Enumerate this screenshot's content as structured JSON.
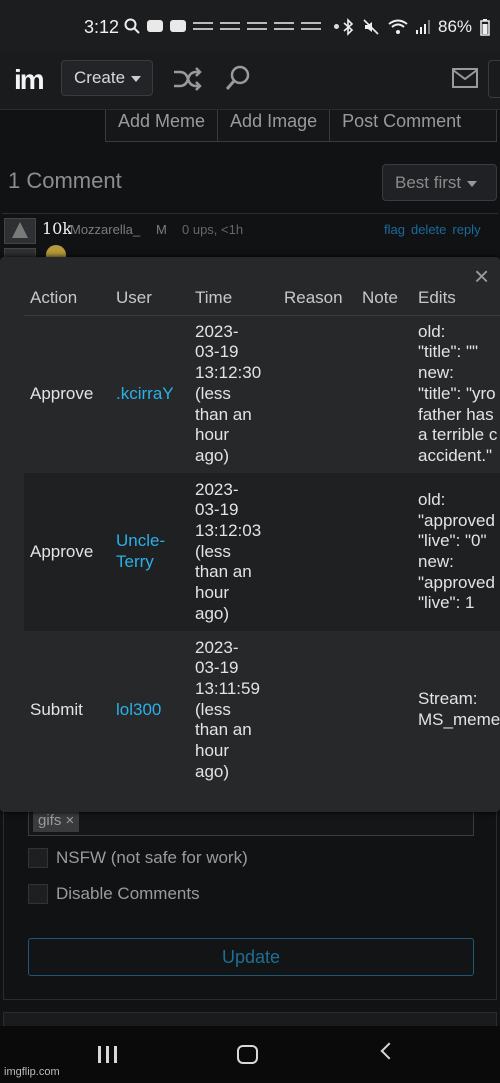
{
  "status_bar": {
    "time": "3:12",
    "battery": "86%"
  },
  "app_bar": {
    "logo_text": "im",
    "create_label": "Create"
  },
  "actions": {
    "add_meme": "Add Meme",
    "add_image": "Add Image",
    "post_comment": "Post Comment"
  },
  "comments": {
    "title": "1 Comment",
    "sort_label": "Best first",
    "items": [
      {
        "badge": "10k",
        "user": "Mozzarella_",
        "gender": "M",
        "meta": "0 ups, <1h",
        "links": [
          "flag",
          "delete",
          "reply"
        ]
      }
    ]
  },
  "modal": {
    "close_label": "×",
    "headers": [
      "Action",
      "User",
      "Time",
      "Reason",
      "Note",
      "Edits"
    ],
    "rows": [
      {
        "action": "Approve",
        "user": ".kcirraY",
        "time": "2023-\n03-19\n13:12:30\n(less\nthan an\nhour\nago)",
        "reason": "",
        "note": "",
        "edits": "old:\n\"title\": \"\"\nnew:\n\"title\": \"yro\nfather has\na terrible c\naccident.\""
      },
      {
        "action": "Approve",
        "user": "Uncle-\nTerry",
        "time": "2023-\n03-19\n13:12:03\n(less\nthan an\nhour\nago)",
        "reason": "",
        "note": "",
        "edits": "old:\n\"approved\n\"live\": \"0\"\nnew:\n\"approved\n\"live\": 1"
      },
      {
        "action": "Submit",
        "user": "lol300",
        "time": "2023-\n03-19\n13:11:59\n(less\nthan an\nhour\nago)",
        "reason": "",
        "note": "",
        "edits": "Stream:\nMS_meme"
      }
    ]
  },
  "form": {
    "tag": "gifs ×",
    "nsfw_label": "NSFW (not safe for work)",
    "disable_comments_label": "Disable Comments",
    "update_label": "Update"
  },
  "watermark": "imgflip.com",
  "colors": {
    "link": "#2ab0e8",
    "logo": "#ee3333",
    "accent_blue": "#1f6e97"
  }
}
